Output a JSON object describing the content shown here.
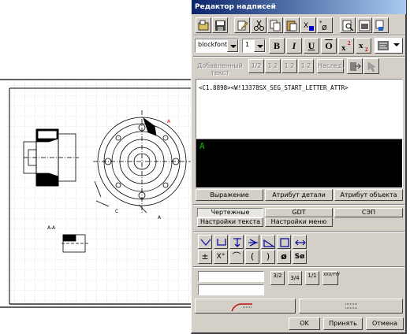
{
  "dialog": {
    "title": "Редактор надписей",
    "font_name": "blockfont",
    "font_size": "1",
    "format_buttons": {
      "bold": "B",
      "italic": "I",
      "underline": "U",
      "overline": "O"
    },
    "append_text_label": "Добавленный текст",
    "inherit_button": "Наслед.",
    "stack_labels": [
      "1/2",
      "1 2",
      "1 2",
      "1 2"
    ],
    "text_value": "<C1.8898><W!13378SX_SEG_START_LETTER_ATTR>",
    "preview_text": "A",
    "attr_buttons": [
      "Выражение",
      "Атрибут детали",
      "Атрибут объекта"
    ],
    "tabs_row1": [
      "Чертежные символы",
      "GDT",
      "СЭП"
    ],
    "tabs_row2": [
      "Настройки текста",
      "Настройки меню"
    ],
    "symbols_row2_text": [
      "±",
      "X°",
      "⌒",
      "(",
      ")",
      "ø",
      "Sø"
    ],
    "fraction_labels": [
      "3/2",
      "3/4",
      "1/1",
      "XXX/YYY"
    ],
    "ok_button": "OK",
    "apply_button": "Принять",
    "cancel_button": "Отмена"
  },
  "drawing": {
    "labels": [
      "A-A",
      "C",
      "A",
      "A"
    ]
  }
}
